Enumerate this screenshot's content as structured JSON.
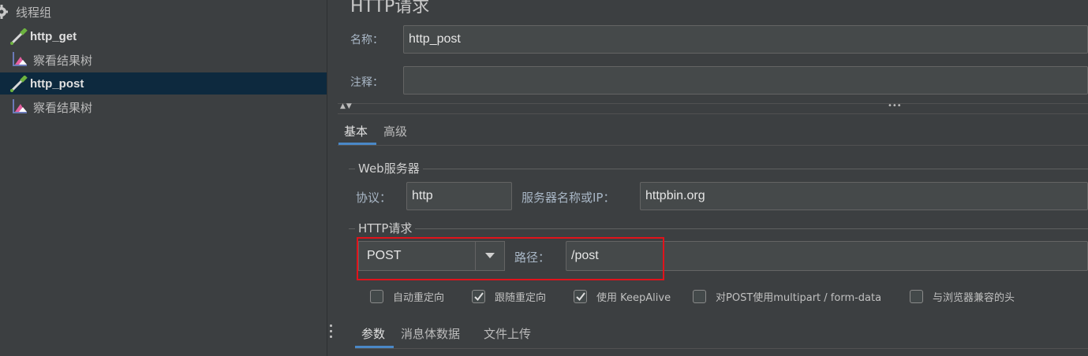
{
  "tree": {
    "items": [
      {
        "label": "线程组",
        "icon": "gear-icon",
        "latin": false
      },
      {
        "label": "http_get",
        "icon": "pipette-icon",
        "latin": true
      },
      {
        "label": "察看结果树",
        "icon": "chart-icon",
        "latin": false
      },
      {
        "label": "http_post",
        "icon": "pipette-icon",
        "latin": true,
        "selected": true
      },
      {
        "label": "察看结果树",
        "icon": "chart-icon",
        "latin": false
      }
    ]
  },
  "panel": {
    "title": "HTTP请求",
    "name_label": "名称：",
    "name_value": "http_post",
    "comment_label": "注释：",
    "comment_value": "",
    "collapse_arrows": "▲▼",
    "ellipsis": "•••"
  },
  "tabs": {
    "basic": "基本",
    "advanced": "高级"
  },
  "web_server": {
    "group_title": "Web服务器",
    "protocol_label": "协议：",
    "protocol_value": "http",
    "server_label": "服务器名称或IP：",
    "server_value": "httpbin.org"
  },
  "http_request": {
    "group_title": "HTTP请求",
    "method_value": "POST",
    "path_label": "路径：",
    "path_value": "/post"
  },
  "options": [
    {
      "label": "自动重定向",
      "checked": false
    },
    {
      "label": "跟随重定向",
      "checked": true
    },
    {
      "label": "使用 KeepAlive",
      "checked": true
    },
    {
      "label": "对POST使用multipart / form-data",
      "checked": false
    },
    {
      "label": "与浏览器兼容的头",
      "checked": false
    }
  ],
  "sub_tabs": {
    "params": "参数",
    "body": "消息体数据",
    "upload": "文件上传"
  },
  "colors": {
    "background": "#3c3f41",
    "selection": "#0d293e",
    "accent": "#4a88c7",
    "highlight_box": "#e0131b"
  }
}
